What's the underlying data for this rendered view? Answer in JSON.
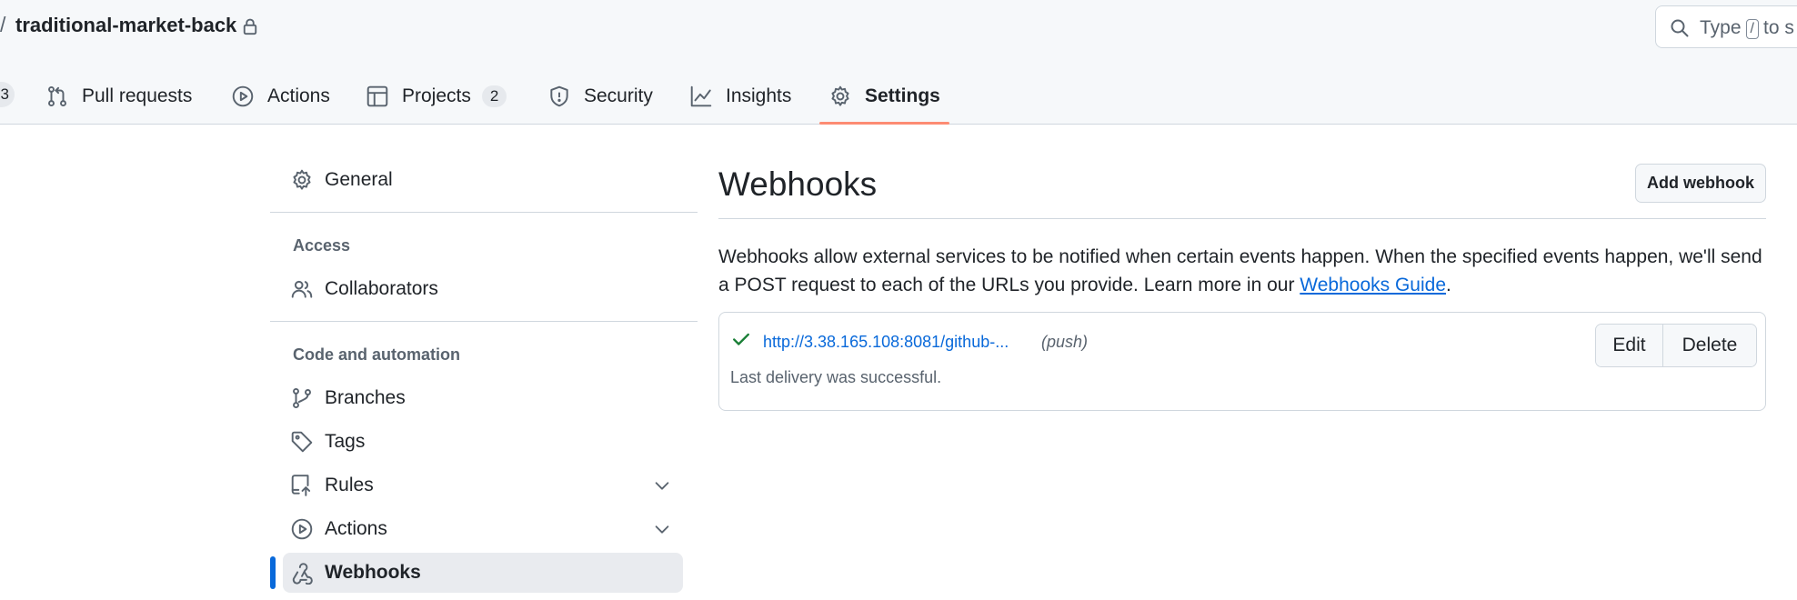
{
  "header": {
    "path_separator": "/",
    "repo_name": "traditional-market-back",
    "search": {
      "text_before": "Type",
      "key": "/",
      "text_after": "to s"
    }
  },
  "nav": {
    "hidden_counter": "3",
    "items": [
      {
        "label": "Pull requests",
        "icon": "git-pull-request-icon"
      },
      {
        "label": "Actions",
        "icon": "play-icon"
      },
      {
        "label": "Projects",
        "icon": "table-icon",
        "counter": "2"
      },
      {
        "label": "Security",
        "icon": "shield-icon"
      },
      {
        "label": "Insights",
        "icon": "graph-icon"
      },
      {
        "label": "Settings",
        "icon": "gear-icon",
        "selected": true
      }
    ]
  },
  "sidebar": {
    "general": "General",
    "access_heading": "Access",
    "collaborators": "Collaborators",
    "code_heading": "Code and automation",
    "branches": "Branches",
    "tags": "Tags",
    "rules": "Rules",
    "actions": "Actions",
    "webhooks": "Webhooks"
  },
  "main": {
    "title": "Webhooks",
    "add_button": "Add webhook",
    "description": "Webhooks allow external services to be notified when certain events happen. When the specified events happen, we'll send a POST request to each of the URLs you provide. Learn more in our ",
    "guide_link": "Webhooks Guide",
    "description_end": ".",
    "webhook": {
      "url": "http://3.38.165.108:8081/github-...",
      "events": "(push)",
      "status": "Last delivery was successful.",
      "edit_label": "Edit",
      "delete_label": "Delete"
    }
  },
  "colors": {
    "accent_blue": "#0969da",
    "success_green": "#1a7f37",
    "tab_underline": "#fd8c73"
  }
}
